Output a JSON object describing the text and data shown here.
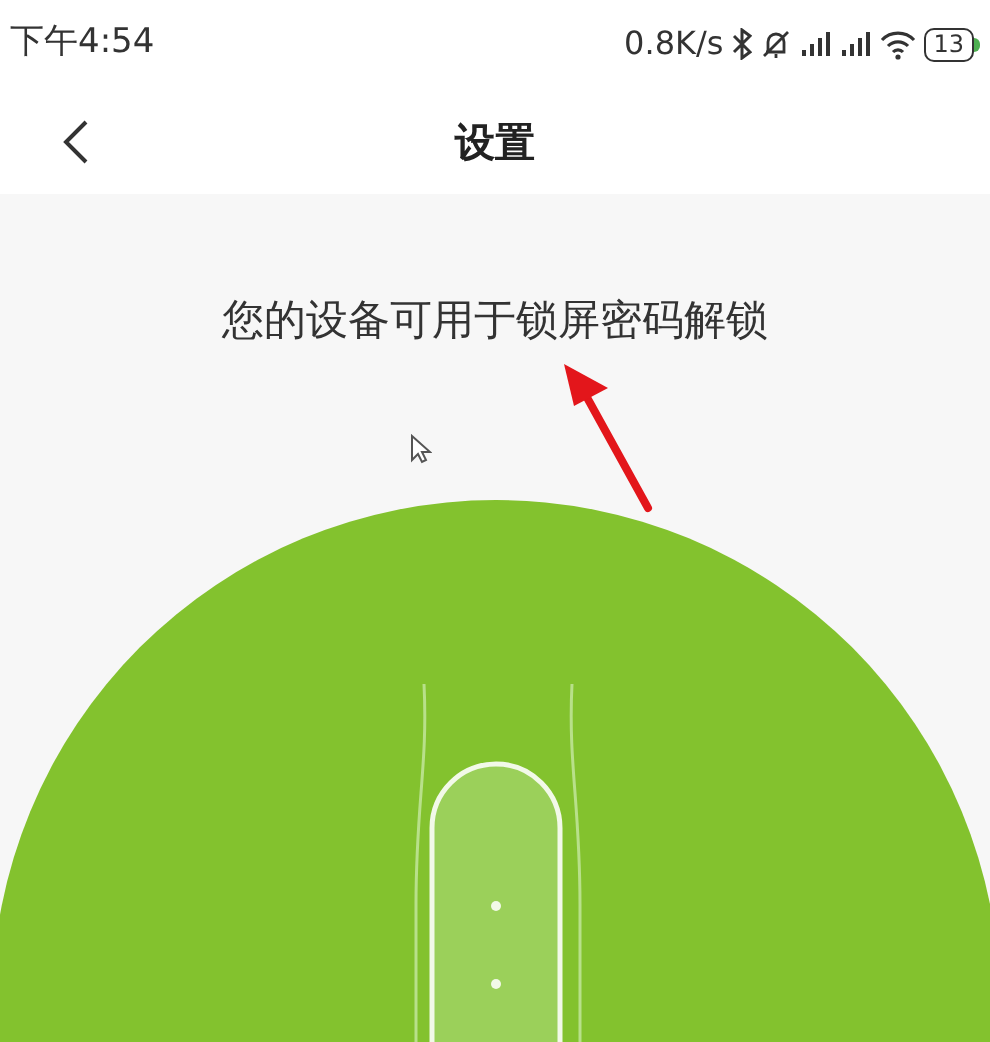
{
  "status_bar": {
    "time": "下午4:54",
    "net_speed": "0.8K/s",
    "battery": "13"
  },
  "header": {
    "title": "设置"
  },
  "message": "您的设备可用于锁屏密码解锁"
}
